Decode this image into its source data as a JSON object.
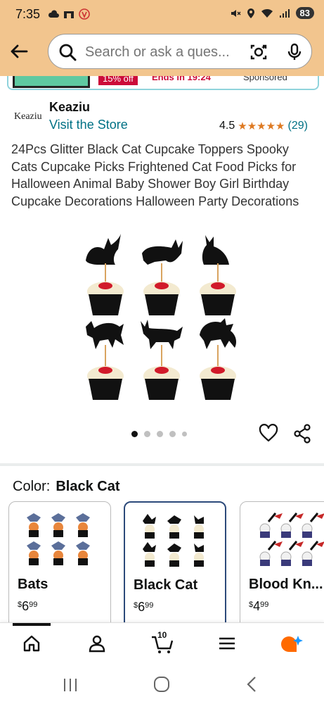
{
  "status": {
    "time": "7:35",
    "battery": "83"
  },
  "search": {
    "placeholder": "Search or ask a ques..."
  },
  "ad": {
    "deal": "15% off",
    "ends": "Ends in 19:24",
    "sponsored": "Sponsored"
  },
  "brand": {
    "logo": "Keaziu",
    "name": "Keaziu",
    "store_link": "Visit the Store"
  },
  "rating": {
    "value": "4.5",
    "stars": "★★★★★",
    "count": "(29)"
  },
  "product": {
    "title": "24Pcs Glitter Black Cat Cupcake Toppers Spooky Cats Cupcake Picks Frightened Cat Food Picks for Halloween Animal Baby Shower Boy Girl Birthday Cupcake Decorations Halloween Party Decorations"
  },
  "color": {
    "label": "Color:",
    "selected": "Black Cat"
  },
  "swatches": [
    {
      "name": "Bats",
      "dollar": "$",
      "whole": "6",
      "cents": "99"
    },
    {
      "name": "Black Cat",
      "dollar": "$",
      "whole": "6",
      "cents": "99"
    },
    {
      "name": "Blood Kn...",
      "dollar": "$",
      "whole": "4",
      "cents": "99"
    }
  ],
  "nav": {
    "cart_count": "10"
  },
  "colors": {
    "header_bg": "#f2c58e",
    "link": "#007185",
    "star": "#de7921",
    "selected_border": "#2c4a7a",
    "accent_orange": "#ff6a00",
    "accent_blue": "#1a98ff"
  },
  "icons": [
    "back-arrow-icon",
    "search-icon",
    "camera-lens-icon",
    "mic-icon",
    "heart-icon",
    "share-icon",
    "home-icon",
    "account-icon",
    "cart-icon",
    "menu-icon",
    "rufus-icon"
  ]
}
